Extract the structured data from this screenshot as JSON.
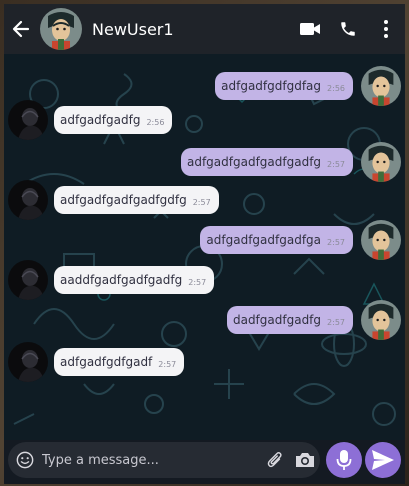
{
  "header": {
    "contact_name": "NewUser1",
    "back_icon": "arrow-left-icon",
    "video_icon": "video-camera-icon",
    "call_icon": "phone-icon",
    "menu_icon": "more-vertical-icon"
  },
  "messages": [
    {
      "direction": "out",
      "text": "adfgadfgdfgdfag",
      "time": "2:56"
    },
    {
      "direction": "in",
      "text": "adfgadfgadfg",
      "time": "2:56"
    },
    {
      "direction": "out",
      "text": "adfgadfgadfgadfgadfg",
      "time": "2:57"
    },
    {
      "direction": "in",
      "text": "adfgadfgadfgadfgdfg",
      "time": "2:57"
    },
    {
      "direction": "out",
      "text": "adfgadfgadfgadfga",
      "time": "2:57"
    },
    {
      "direction": "in",
      "text": "aaddfgadfgadfgadfg",
      "time": "2:57"
    },
    {
      "direction": "out",
      "text": "dadfgadfgadfg",
      "time": "2:57"
    },
    {
      "direction": "in",
      "text": "adfgadfgdfgadf",
      "time": "2:57"
    }
  ],
  "composer": {
    "placeholder": "Type a message...",
    "emoji_icon": "emoji-icon",
    "attach_icon": "paperclip-icon",
    "camera_icon": "camera-icon",
    "mic_icon": "microphone-icon",
    "send_icon": "send-icon"
  },
  "colors": {
    "header_bg": "#1f2329",
    "chat_bg": "#0d1a22",
    "outgoing_bubble": "#c2b4e6",
    "incoming_bubble": "#f4f4f6",
    "accent": "#8d6fd6"
  }
}
